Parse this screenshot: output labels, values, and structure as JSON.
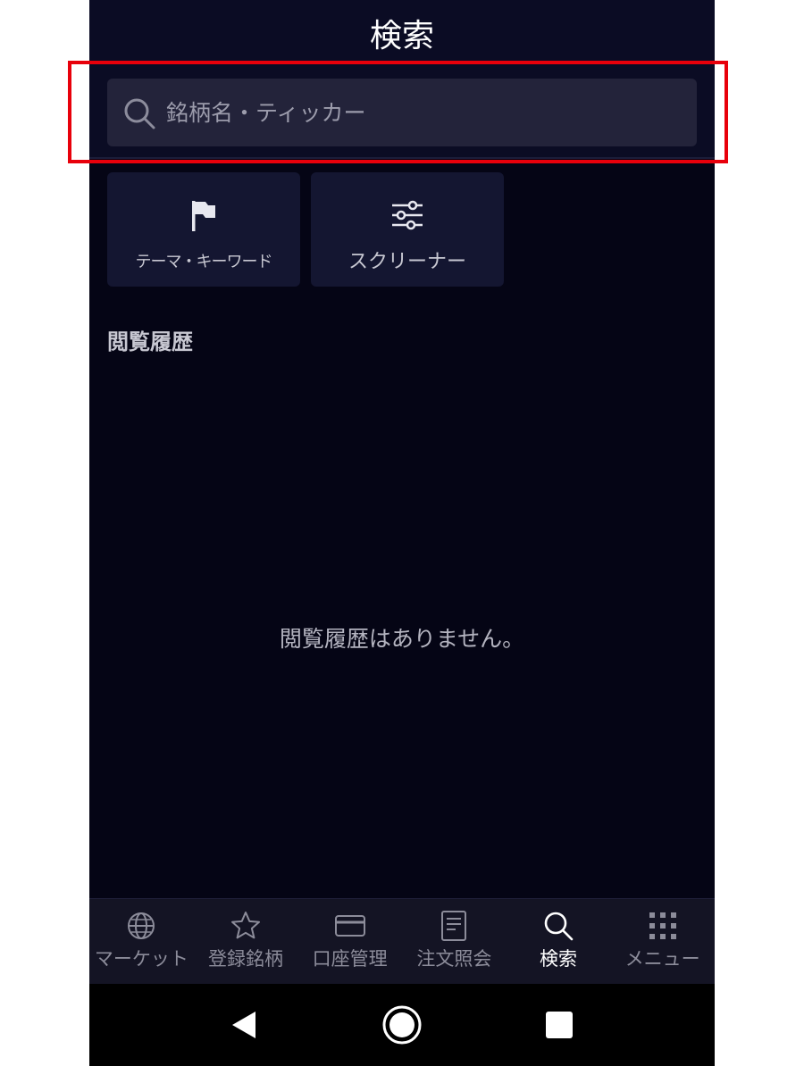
{
  "header": {
    "title": "検索"
  },
  "search": {
    "placeholder": "銘柄名・ティッカー",
    "value": "",
    "icon": "search-icon"
  },
  "shortcuts": [
    {
      "label": "テーマ・キーワード",
      "icon": "flag-icon"
    },
    {
      "label": "スクリーナー",
      "icon": "sliders-icon"
    }
  ],
  "history": {
    "heading": "閲覧履歴",
    "empty_message": "閲覧履歴はありません。"
  },
  "tabbar": {
    "items": [
      {
        "label": "マーケット",
        "icon": "globe-icon",
        "active": false
      },
      {
        "label": "登録銘柄",
        "icon": "star-icon",
        "active": false
      },
      {
        "label": "口座管理",
        "icon": "card-icon",
        "active": false
      },
      {
        "label": "注文照会",
        "icon": "document-icon",
        "active": false
      },
      {
        "label": "検索",
        "icon": "search-icon",
        "active": true
      },
      {
        "label": "メニュー",
        "icon": "grid-menu-icon",
        "active": false
      }
    ]
  },
  "system_nav": {
    "buttons": [
      "back-icon",
      "home-icon",
      "recents-icon"
    ]
  },
  "colors": {
    "background": "#050515",
    "header": "#0b0c24",
    "search_box": "#23233a",
    "tile": "#141631",
    "tabbar": "#141424",
    "highlight": "#e8000b"
  }
}
